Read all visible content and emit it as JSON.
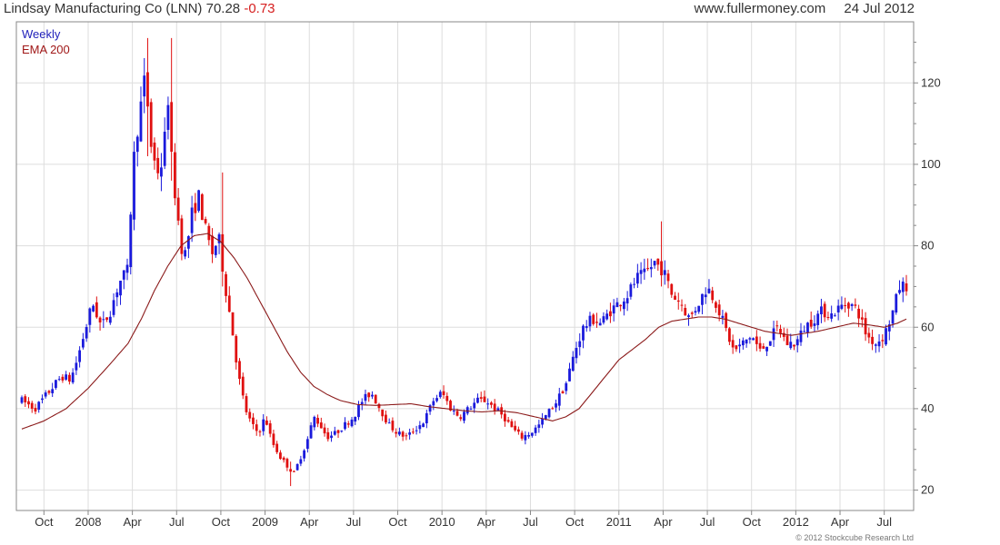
{
  "header": {
    "title": "Lindsay Manufacturing Co (LNN)",
    "price": "70.28",
    "change": "-0.73",
    "site": "www.fullermoney.com",
    "date": "24 Jul 2012"
  },
  "copyright": "© 2012 Stockcube Research Ltd",
  "colors": {
    "up": "#1a1adc",
    "down": "#e01010",
    "ema": "#8b1a1a",
    "grid": "#dddddd",
    "frame": "#888888"
  },
  "chart_data": {
    "type": "candlestick",
    "legend": [
      {
        "label": "Weekly",
        "color": "#2222bb"
      },
      {
        "label": "EMA 200",
        "color": "#a01818"
      }
    ],
    "legend_position": "top-left",
    "grid": true,
    "y_axis": {
      "side": "right",
      "ylim": [
        15,
        135
      ],
      "ticks": [
        20,
        40,
        60,
        80,
        100,
        120
      ]
    },
    "x_axis": {
      "ticks": [
        {
          "label": "Oct",
          "t": 0.5
        },
        {
          "label": "2008",
          "t": 1.5
        },
        {
          "label": "Apr",
          "t": 2.5
        },
        {
          "label": "Jul",
          "t": 3.5
        },
        {
          "label": "Oct",
          "t": 4.5
        },
        {
          "label": "2009",
          "t": 5.5
        },
        {
          "label": "Apr",
          "t": 6.5
        },
        {
          "label": "Jul",
          "t": 7.5
        },
        {
          "label": "Oct",
          "t": 8.5
        },
        {
          "label": "2010",
          "t": 9.5
        },
        {
          "label": "Apr",
          "t": 10.5
        },
        {
          "label": "Jul",
          "t": 11.5
        },
        {
          "label": "Oct",
          "t": 12.5
        },
        {
          "label": "2011",
          "t": 13.5
        },
        {
          "label": "Apr",
          "t": 14.5
        },
        {
          "label": "Jul",
          "t": 15.5
        },
        {
          "label": "Oct",
          "t": 16.5
        },
        {
          "label": "2012",
          "t": 17.5
        },
        {
          "label": "Apr",
          "t": 18.5
        },
        {
          "label": "Jul",
          "t": 19.5
        }
      ],
      "t_range": [
        0,
        20
      ],
      "t_unit": "quarters (0 = start of displayed range, approx. Aug 2007)"
    },
    "price_path": [
      [
        0.0,
        42
      ],
      [
        0.3,
        40
      ],
      [
        0.6,
        44
      ],
      [
        0.9,
        48
      ],
      [
        1.1,
        47
      ],
      [
        1.25,
        52
      ],
      [
        1.4,
        58
      ],
      [
        1.6,
        66
      ],
      [
        1.8,
        60
      ],
      [
        2.0,
        64
      ],
      [
        2.2,
        71
      ],
      [
        2.4,
        74
      ],
      [
        2.5,
        98
      ],
      [
        2.6,
        108
      ],
      [
        2.8,
        122
      ],
      [
        2.9,
        106
      ],
      [
        3.05,
        98
      ],
      [
        3.2,
        101
      ],
      [
        3.3,
        118
      ],
      [
        3.4,
        98
      ],
      [
        3.5,
        90
      ],
      [
        3.6,
        80
      ],
      [
        3.7,
        78
      ],
      [
        3.85,
        88
      ],
      [
        4.0,
        92
      ],
      [
        4.15,
        84
      ],
      [
        4.3,
        78
      ],
      [
        4.45,
        82
      ],
      [
        4.6,
        70
      ],
      [
        4.75,
        60
      ],
      [
        4.9,
        48
      ],
      [
        5.05,
        40
      ],
      [
        5.2,
        36
      ],
      [
        5.35,
        34
      ],
      [
        5.5,
        38
      ],
      [
        5.65,
        32
      ],
      [
        5.85,
        28
      ],
      [
        6.0,
        26
      ],
      [
        6.15,
        24
      ],
      [
        6.3,
        28
      ],
      [
        6.45,
        32
      ],
      [
        6.6,
        38
      ],
      [
        6.75,
        36
      ],
      [
        6.9,
        33
      ],
      [
        7.1,
        34
      ],
      [
        7.3,
        36
      ],
      [
        7.5,
        38
      ],
      [
        7.7,
        42
      ],
      [
        7.9,
        44
      ],
      [
        8.1,
        40
      ],
      [
        8.3,
        36
      ],
      [
        8.5,
        34
      ],
      [
        8.7,
        33
      ],
      [
        8.9,
        35
      ],
      [
        9.1,
        37
      ],
      [
        9.3,
        42
      ],
      [
        9.5,
        44
      ],
      [
        9.7,
        40
      ],
      [
        9.9,
        38
      ],
      [
        10.1,
        40
      ],
      [
        10.3,
        42
      ],
      [
        10.5,
        42
      ],
      [
        10.7,
        40
      ],
      [
        10.9,
        38
      ],
      [
        11.1,
        35
      ],
      [
        11.3,
        33
      ],
      [
        11.5,
        34
      ],
      [
        11.7,
        36
      ],
      [
        11.9,
        39
      ],
      [
        12.1,
        42
      ],
      [
        12.3,
        46
      ],
      [
        12.5,
        54
      ],
      [
        12.7,
        60
      ],
      [
        12.9,
        62
      ],
      [
        13.1,
        61
      ],
      [
        13.3,
        64
      ],
      [
        13.5,
        66
      ],
      [
        13.7,
        68
      ],
      [
        13.9,
        72
      ],
      [
        14.1,
        73
      ],
      [
        14.3,
        76
      ],
      [
        14.5,
        74
      ],
      [
        14.7,
        68
      ],
      [
        14.9,
        66
      ],
      [
        15.1,
        62
      ],
      [
        15.3,
        66
      ],
      [
        15.5,
        70
      ],
      [
        15.7,
        66
      ],
      [
        15.9,
        60
      ],
      [
        16.1,
        54
      ],
      [
        16.3,
        56
      ],
      [
        16.5,
        58
      ],
      [
        16.7,
        54
      ],
      [
        16.9,
        57
      ],
      [
        17.1,
        60
      ],
      [
        17.3,
        56
      ],
      [
        17.5,
        56
      ],
      [
        17.7,
        60
      ],
      [
        17.9,
        62
      ],
      [
        18.1,
        64
      ],
      [
        18.3,
        63
      ],
      [
        18.5,
        65
      ],
      [
        18.7,
        66
      ],
      [
        18.9,
        64
      ],
      [
        19.1,
        58
      ],
      [
        19.3,
        56
      ],
      [
        19.5,
        58
      ],
      [
        19.7,
        64
      ],
      [
        19.85,
        70
      ],
      [
        20.0,
        70.28
      ]
    ],
    "ema_path": [
      [
        0.0,
        35
      ],
      [
        0.5,
        37
      ],
      [
        1.0,
        40
      ],
      [
        1.5,
        45
      ],
      [
        2.0,
        51
      ],
      [
        2.4,
        56
      ],
      [
        2.7,
        62
      ],
      [
        3.0,
        69
      ],
      [
        3.3,
        75
      ],
      [
        3.6,
        80
      ],
      [
        3.9,
        82.5
      ],
      [
        4.2,
        83
      ],
      [
        4.5,
        81
      ],
      [
        4.8,
        77
      ],
      [
        5.1,
        72
      ],
      [
        5.4,
        66
      ],
      [
        5.7,
        60
      ],
      [
        6.0,
        54
      ],
      [
        6.3,
        49
      ],
      [
        6.6,
        45.5
      ],
      [
        6.9,
        43.5
      ],
      [
        7.2,
        42
      ],
      [
        7.6,
        41
      ],
      [
        8.0,
        40.8
      ],
      [
        8.4,
        41
      ],
      [
        8.8,
        41.2
      ],
      [
        9.2,
        40.5
      ],
      [
        9.6,
        40
      ],
      [
        10.0,
        39.5
      ],
      [
        10.4,
        39.2
      ],
      [
        10.8,
        39.5
      ],
      [
        11.2,
        39
      ],
      [
        11.6,
        38
      ],
      [
        12.0,
        37
      ],
      [
        12.3,
        38
      ],
      [
        12.6,
        40
      ],
      [
        12.9,
        44
      ],
      [
        13.2,
        48
      ],
      [
        13.5,
        52
      ],
      [
        13.8,
        54.5
      ],
      [
        14.1,
        57
      ],
      [
        14.4,
        60
      ],
      [
        14.7,
        61.5
      ],
      [
        15.0,
        62
      ],
      [
        15.3,
        62.5
      ],
      [
        15.6,
        62.5
      ],
      [
        15.9,
        62
      ],
      [
        16.2,
        61
      ],
      [
        16.5,
        60
      ],
      [
        16.8,
        59
      ],
      [
        17.1,
        58.5
      ],
      [
        17.4,
        58
      ],
      [
        17.7,
        58.5
      ],
      [
        18.0,
        59
      ],
      [
        18.4,
        60
      ],
      [
        18.8,
        61
      ],
      [
        19.2,
        60.5
      ],
      [
        19.5,
        60
      ],
      [
        19.8,
        61
      ],
      [
        20.0,
        62
      ]
    ],
    "spikes": [
      {
        "t": 2.85,
        "high": 131,
        "low": 102
      },
      {
        "t": 3.35,
        "high": 131,
        "low": 96
      },
      {
        "t": 4.55,
        "high": 98,
        "low": 70
      },
      {
        "t": 14.45,
        "high": 86,
        "low": 70
      },
      {
        "t": 6.05,
        "high": 27,
        "low": 21
      }
    ]
  }
}
